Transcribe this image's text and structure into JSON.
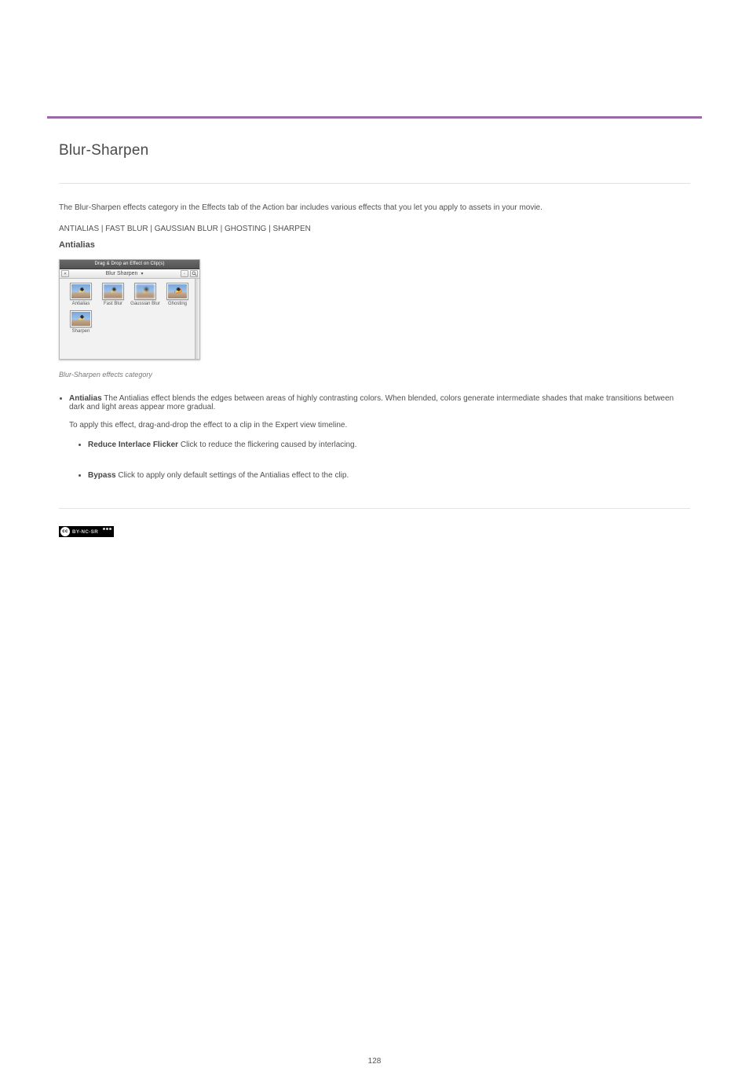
{
  "page_number": "128",
  "title": "Blur-Sharpen",
  "intro": "The Blur-Sharpen effects category in the Effects tab of the Action bar includes various effects that you let you apply to assets in your movie.",
  "intro_caps": "ANTIALIAS | FAST BLUR | GAUSSIAN BLUR | GHOSTING | SHARPEN",
  "subhead": "Antialias",
  "panel": {
    "title": "Drag & Drop an Effect on Clip(s)",
    "dropdown": "Blur Sharpen",
    "thumbs": [
      {
        "label": "Antialias",
        "cls": ""
      },
      {
        "label": "Fast Blur",
        "cls": "blur"
      },
      {
        "label": "Gaussian Blur",
        "cls": "gblur"
      },
      {
        "label": "Ghosting",
        "cls": "ghost"
      },
      {
        "label": "Sharpen",
        "cls": ""
      }
    ]
  },
  "caption": "Blur-Sharpen effects category",
  "bullets": {
    "head": "Antialias",
    "body": "The Antialias effect blends the edges between areas of highly contrasting colors. When blended, colors generate intermediate shades that make transitions between dark and light areas appear more gradual.",
    "para": "To apply this effect, drag-and-drop the effect to a clip in the Expert view timeline.",
    "inner1_head": "Reduce Interlace Flicker",
    "inner1_body": "Click to reduce the flickering caused by interlacing.",
    "inner2_head": "Bypass",
    "inner2_body": "Click to apply only default settings of the Antialias effect to the clip."
  },
  "cc": {
    "label": "BY-NC-SR"
  },
  "colors": {
    "accent": "#9a6aa8"
  }
}
